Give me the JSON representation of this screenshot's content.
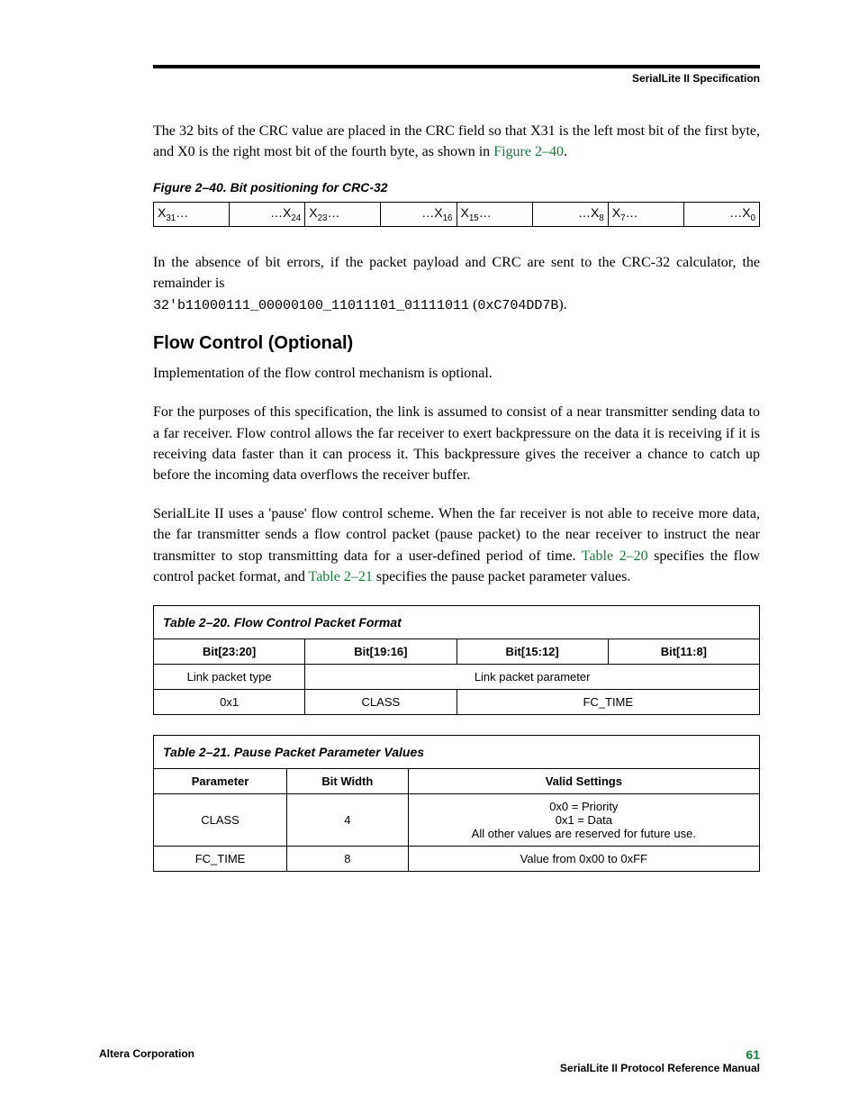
{
  "header": {
    "label": "SerialLite II Specification"
  },
  "intro": {
    "para1_a": "The 32 bits of the CRC value are placed in the CRC field so that X31 is the left most bit of the first byte, and X0 is the right most bit of the fourth byte, as shown in ",
    "para1_ref": "Figure 2–40",
    "para1_b": "."
  },
  "fig240": {
    "caption": "Figure 2–40. Bit positioning for CRC-32",
    "cells": {
      "c0a": "X",
      "c0as": "31",
      "c0b": "…",
      "c0c": "…X",
      "c0cs": "24",
      "c1a": "X",
      "c1as": "23",
      "c1b": "…",
      "c1c": "…X",
      "c1cs": "16",
      "c2a": "X",
      "c2as": "15",
      "c2b": "…",
      "c2c": "…X",
      "c2cs": "8",
      "c3a": "X",
      "c3as": "7",
      "c3b": "…",
      "c3c": "…X",
      "c3cs": "0"
    }
  },
  "crc": {
    "para_a": "In the absence of bit errors, if the packet payload and CRC are sent to the CRC-32 calculator, the remainder is",
    "mono1": "32'b11000111_00000100_11011101_01111011",
    "mono_paren_a": " (",
    "mono2": "0xC704DD7B",
    "mono_paren_b": ")."
  },
  "flow": {
    "heading": "Flow Control (Optional)",
    "p1": "Implementation of the flow control mechanism is optional.",
    "p2": "For the purposes of this specification, the link is assumed to consist of a near transmitter sending data to a far receiver. Flow control allows the far receiver to exert backpressure on the data it is receiving if it is receiving data faster than it can process it. This backpressure gives the receiver a chance to catch up before the incoming data overflows the receiver buffer.",
    "p3_a": "SerialLite II uses a 'pause' flow control scheme. When the far receiver is not able to receive more data, the far transmitter sends a flow control packet (pause packet) to the near receiver to instruct the near transmitter to stop transmitting data for a user-defined period of time. ",
    "p3_ref1": "Table 2–20",
    "p3_b": " specifies the flow control packet format, and ",
    "p3_ref2": "Table 2–21",
    "p3_c": " specifies the pause packet parameter values."
  },
  "table220": {
    "title": "Table 2–20. Flow Control Packet Format",
    "h1": "Bit[23:20]",
    "h2": "Bit[19:16]",
    "h3": "Bit[15:12]",
    "h4": "Bit[11:8]",
    "r1c1": "Link packet type",
    "r1c2": "Link packet parameter",
    "r2c1": "0x1",
    "r2c2": "CLASS",
    "r2c3": "FC_TIME"
  },
  "table221": {
    "title": "Table 2–21. Pause Packet Parameter Values",
    "h1": "Parameter",
    "h2": "Bit Width",
    "h3": "Valid Settings",
    "r1c1": "CLASS",
    "r1c2": "4",
    "r1c3_l1": "0x0 = Priority",
    "r1c3_l2": "0x1 = Data",
    "r1c3_l3": "All other values are reserved for future use.",
    "r2c1": "FC_TIME",
    "r2c2": "8",
    "r2c3": "Value from 0x00 to 0xFF"
  },
  "footer": {
    "left": "Altera Corporation",
    "page": "61",
    "manual": "SerialLite II Protocol Reference Manual"
  }
}
